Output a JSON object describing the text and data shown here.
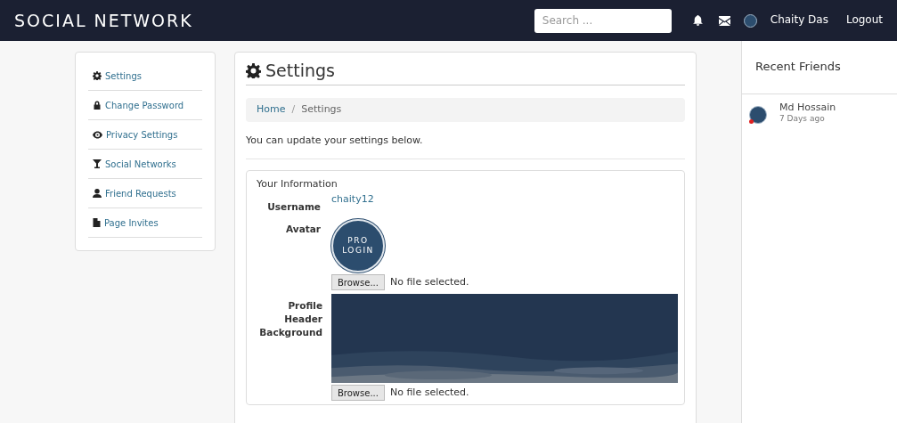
{
  "navbar": {
    "brand": "SOCIAL NETWORK",
    "search": {
      "placeholder": "Search ..."
    },
    "user_name": "Chaity Das",
    "logout": "Logout"
  },
  "settings_menu": [
    {
      "kind": "gear",
      "label": "Settings"
    },
    {
      "kind": "lock",
      "label": "Change Password"
    },
    {
      "kind": "eye",
      "label": "Privacy Settings"
    },
    {
      "kind": "filter",
      "label": "Social Networks"
    },
    {
      "kind": "user",
      "label": "Friend Requests"
    },
    {
      "kind": "file",
      "label": "Page Invites"
    }
  ],
  "main": {
    "title": "Settings",
    "breadcrumb": [
      "Home",
      "Settings"
    ],
    "breadcrumb_separator": "/",
    "intro": "You can update your settings below.",
    "section": {
      "title": "Your Information",
      "username_label": "Username",
      "username": "chaity12",
      "avatar_label": "Avatar",
      "avatar_text": [
        "PRO",
        "LOGIN"
      ],
      "avatar_file": {
        "button": "Browse...",
        "status": "No file selected."
      },
      "header_label": "Profile Header Background",
      "header_file": {
        "button": "Browse...",
        "status": "No file selected."
      }
    }
  },
  "recent_friends": {
    "title": "Recent Friends",
    "items": [
      {
        "name": "Md Hossain",
        "time": "7 Days ago",
        "online": true
      }
    ]
  }
}
